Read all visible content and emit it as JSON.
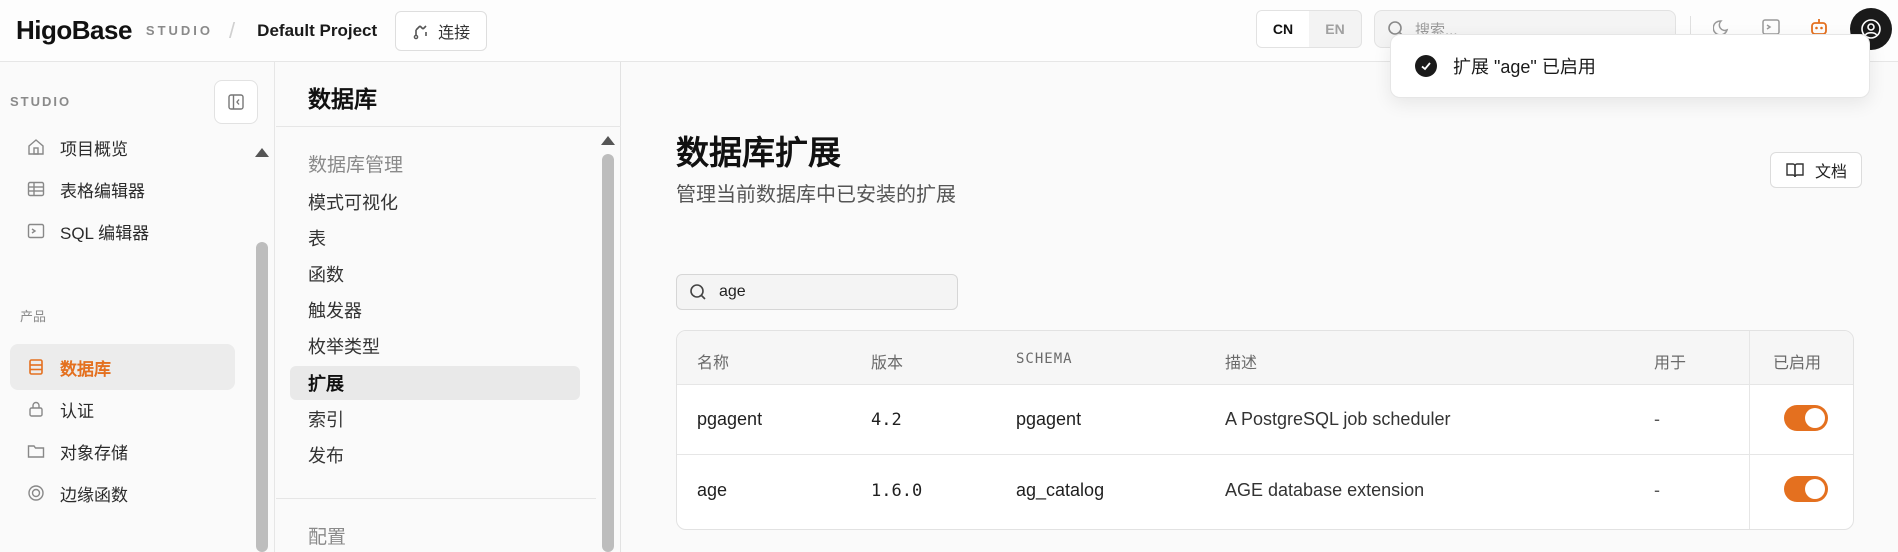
{
  "header": {
    "logo_text": "HigoBase",
    "studio_tag": "STUDIO",
    "separator": "/",
    "project_name": "Default Project",
    "connect_label": "连接",
    "lang": {
      "cn": "CN",
      "en": "EN",
      "selected": "CN"
    },
    "search_placeholder": "搜索..."
  },
  "toast": {
    "message": "扩展 \"age\" 已启用"
  },
  "sidebar": {
    "heading": "STUDIO",
    "section_product": "产品",
    "items": [
      {
        "label": "项目概览",
        "icon": "home-icon"
      },
      {
        "label": "表格编辑器",
        "icon": "table-icon"
      },
      {
        "label": "SQL 编辑器",
        "icon": "terminal-icon"
      },
      {
        "label": "数据库",
        "icon": "database-icon",
        "active": true
      },
      {
        "label": "认证",
        "icon": "lock-icon"
      },
      {
        "label": "对象存储",
        "icon": "folder-icon"
      },
      {
        "label": "边缘函数",
        "icon": "function-icon"
      }
    ]
  },
  "database_menu": {
    "title": "数据库",
    "group": "数据库管理",
    "items": [
      "模式可视化",
      "表",
      "函数",
      "触发器",
      "枚举类型",
      "扩展",
      "索引",
      "发布"
    ],
    "active": "扩展",
    "config_group": "配置"
  },
  "main": {
    "title": "数据库扩展",
    "subtitle": "管理当前数据库中已安装的扩展",
    "docs_label": "文档",
    "filter_value": "age",
    "columns": [
      "名称",
      "版本",
      "SCHEMA",
      "描述",
      "用于",
      "已启用"
    ],
    "rows": [
      {
        "name": "pgagent",
        "version": "4.2",
        "schema": "pgagent",
        "description": "A PostgreSQL job scheduler",
        "used_by": "-",
        "enabled": true
      },
      {
        "name": "age",
        "version": "1.6.0",
        "schema": "ag_catalog",
        "description": "AGE database extension",
        "used_by": "-",
        "enabled": true
      }
    ]
  },
  "colors": {
    "accent": "#e4701f",
    "text": "#1f1f1f",
    "muted": "#8a8a8a"
  }
}
